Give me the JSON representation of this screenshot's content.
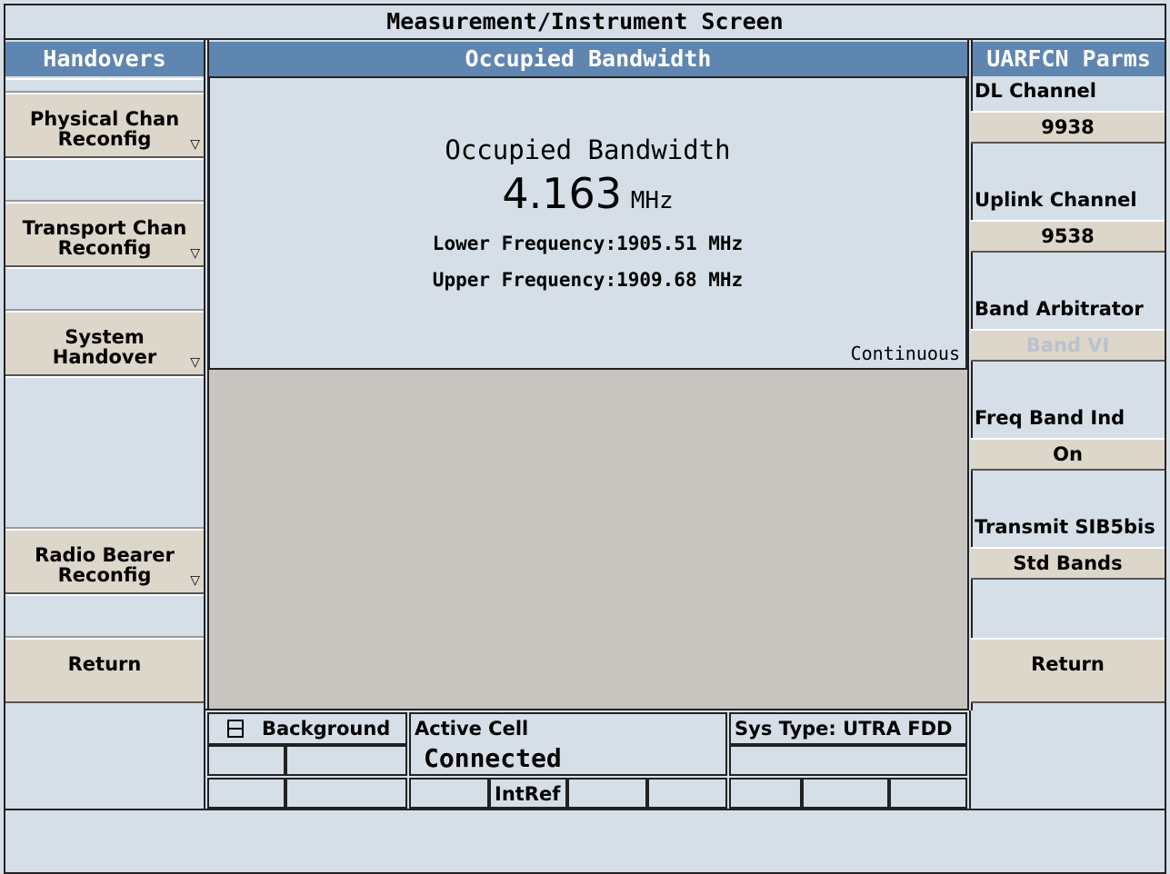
{
  "window": {
    "title": "Measurement/Instrument Screen"
  },
  "left_panel": {
    "header": "Handovers",
    "keys": [
      {
        "line1": "Physical Chan",
        "line2": "Reconfig",
        "has_submenu": true
      },
      {
        "line1": "Transport Chan",
        "line2": "Reconfig",
        "has_submenu": true
      },
      {
        "line1": "System",
        "line2": "Handover",
        "has_submenu": true
      },
      {
        "line1": "Radio Bearer",
        "line2": "Reconfig",
        "has_submenu": true
      }
    ],
    "return_label": "Return"
  },
  "measurement": {
    "header": "Occupied Bandwidth",
    "title": "Occupied Bandwidth",
    "value": "4.163",
    "unit": "MHz",
    "lower_label": "Lower Frequency:",
    "lower_value": "1905.51",
    "lower_unit": "MHz",
    "upper_label": "Upper Frequency:",
    "upper_value": "1909.68",
    "upper_unit": "MHz",
    "mode": "Continuous"
  },
  "right_panel": {
    "header": "UARFCN Parms",
    "params": [
      {
        "label": "DL Channel",
        "value": "9938",
        "enabled": true
      },
      {
        "label": "Uplink Channel",
        "value": "9538",
        "enabled": true
      },
      {
        "label": "Band Arbitrator",
        "value": "Band VI",
        "enabled": false
      },
      {
        "label": "Freq Band Ind",
        "value": "On",
        "enabled": true
      },
      {
        "label": "Transmit SIB5bis",
        "value": "Std Bands",
        "enabled": true
      }
    ],
    "return_label": "Return"
  },
  "status": {
    "background_label": "Background",
    "active_cell_label": "Active Cell",
    "active_cell_value": "Connected",
    "sys_type_label": "Sys Type:",
    "sys_type_value": "UTRA FDD",
    "intref_label": "IntRef"
  },
  "colors": {
    "header_blue": "#5f86b0",
    "softkey_tan": "#ddd6ca",
    "screen_bg": "#d6dfe8",
    "display_gray": "#c8c4c0"
  }
}
